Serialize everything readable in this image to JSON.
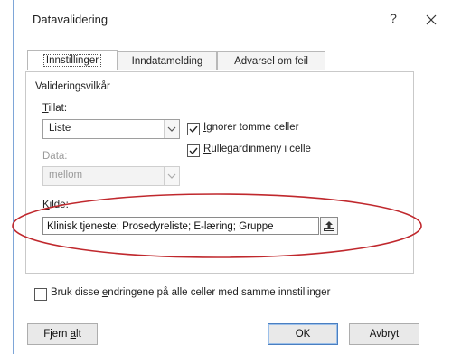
{
  "dialog": {
    "title": "Datavalidering",
    "help_label": "?"
  },
  "tabs": [
    {
      "label": "Innstillinger",
      "active": true
    },
    {
      "label": "Inndatamelding",
      "active": false
    },
    {
      "label": "Advarsel om feil",
      "active": false
    }
  ],
  "settings": {
    "group_title": "Valideringsvilkår",
    "allow": {
      "label_accel": "T",
      "label_rest": "illat:",
      "value": "Liste"
    },
    "data": {
      "label": "Data:",
      "value": "mellom",
      "disabled": true
    },
    "ignore_blank": {
      "checked": true,
      "label_accel": "I",
      "label_rest": "gnorer tomme celler"
    },
    "in_cell_dropdown": {
      "checked": true,
      "label_accel": "R",
      "label_rest": "ullegardinmeny i celle"
    },
    "source": {
      "label_accel": "K",
      "label_rest": "ilde:",
      "value": "Klinisk tjeneste; Prosedyreliste; E-læring; Gruppe"
    }
  },
  "apply_all": {
    "checked": false,
    "label_pre": "Bruk disse ",
    "label_accel": "e",
    "label_rest": "ndringene på alle celler med samme innstillinger"
  },
  "buttons": {
    "clear_all_pre": "Fjern ",
    "clear_all_accel": "a",
    "clear_all_rest": "lt",
    "ok": "OK",
    "cancel": "Avbryt"
  },
  "colors": {
    "highlight_ellipse": "#c0282d",
    "default_button_border": "#4a7fc1",
    "window_edge": "#7ea6d8"
  }
}
